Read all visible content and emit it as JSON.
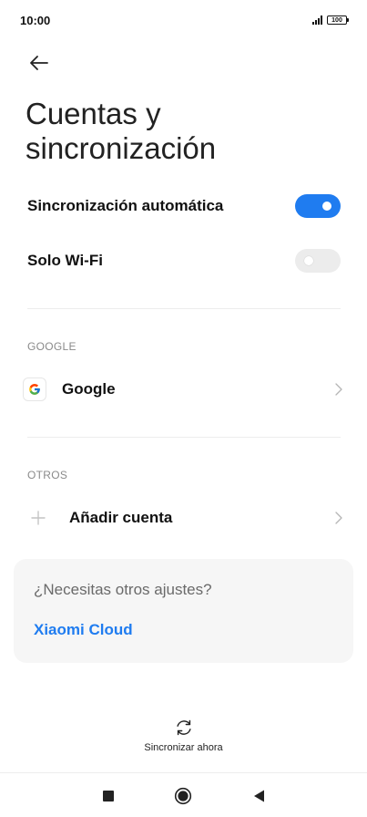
{
  "status_bar": {
    "time": "10:00",
    "battery": "100"
  },
  "header": {
    "title_line1": "Cuentas y",
    "title_line2": "sincronización"
  },
  "settings": {
    "auto_sync": {
      "label": "Sincronización automática",
      "enabled": true
    },
    "wifi_only": {
      "label": "Solo Wi-Fi",
      "enabled": false
    }
  },
  "sections": {
    "google": {
      "header": "GOOGLE",
      "account_label": "Google"
    },
    "others": {
      "header": "OTROS",
      "add_account_label": "Añadir cuenta"
    }
  },
  "card": {
    "title": "¿Necesitas otros ajustes?",
    "link": "Xiaomi Cloud"
  },
  "sync_now": {
    "label": "Sincronizar ahora"
  },
  "colors": {
    "accent": "#1f7cf0",
    "toggle_off": "#ececec",
    "card_bg": "#f6f6f6"
  },
  "icons": {
    "back": "arrow-left-icon",
    "google": "google-logo-icon",
    "add": "plus-icon",
    "chevron": "chevron-right-icon",
    "sync": "sync-icon",
    "nav_recents": "square-icon",
    "nav_home": "circle-icon",
    "nav_back": "triangle-back-icon"
  }
}
